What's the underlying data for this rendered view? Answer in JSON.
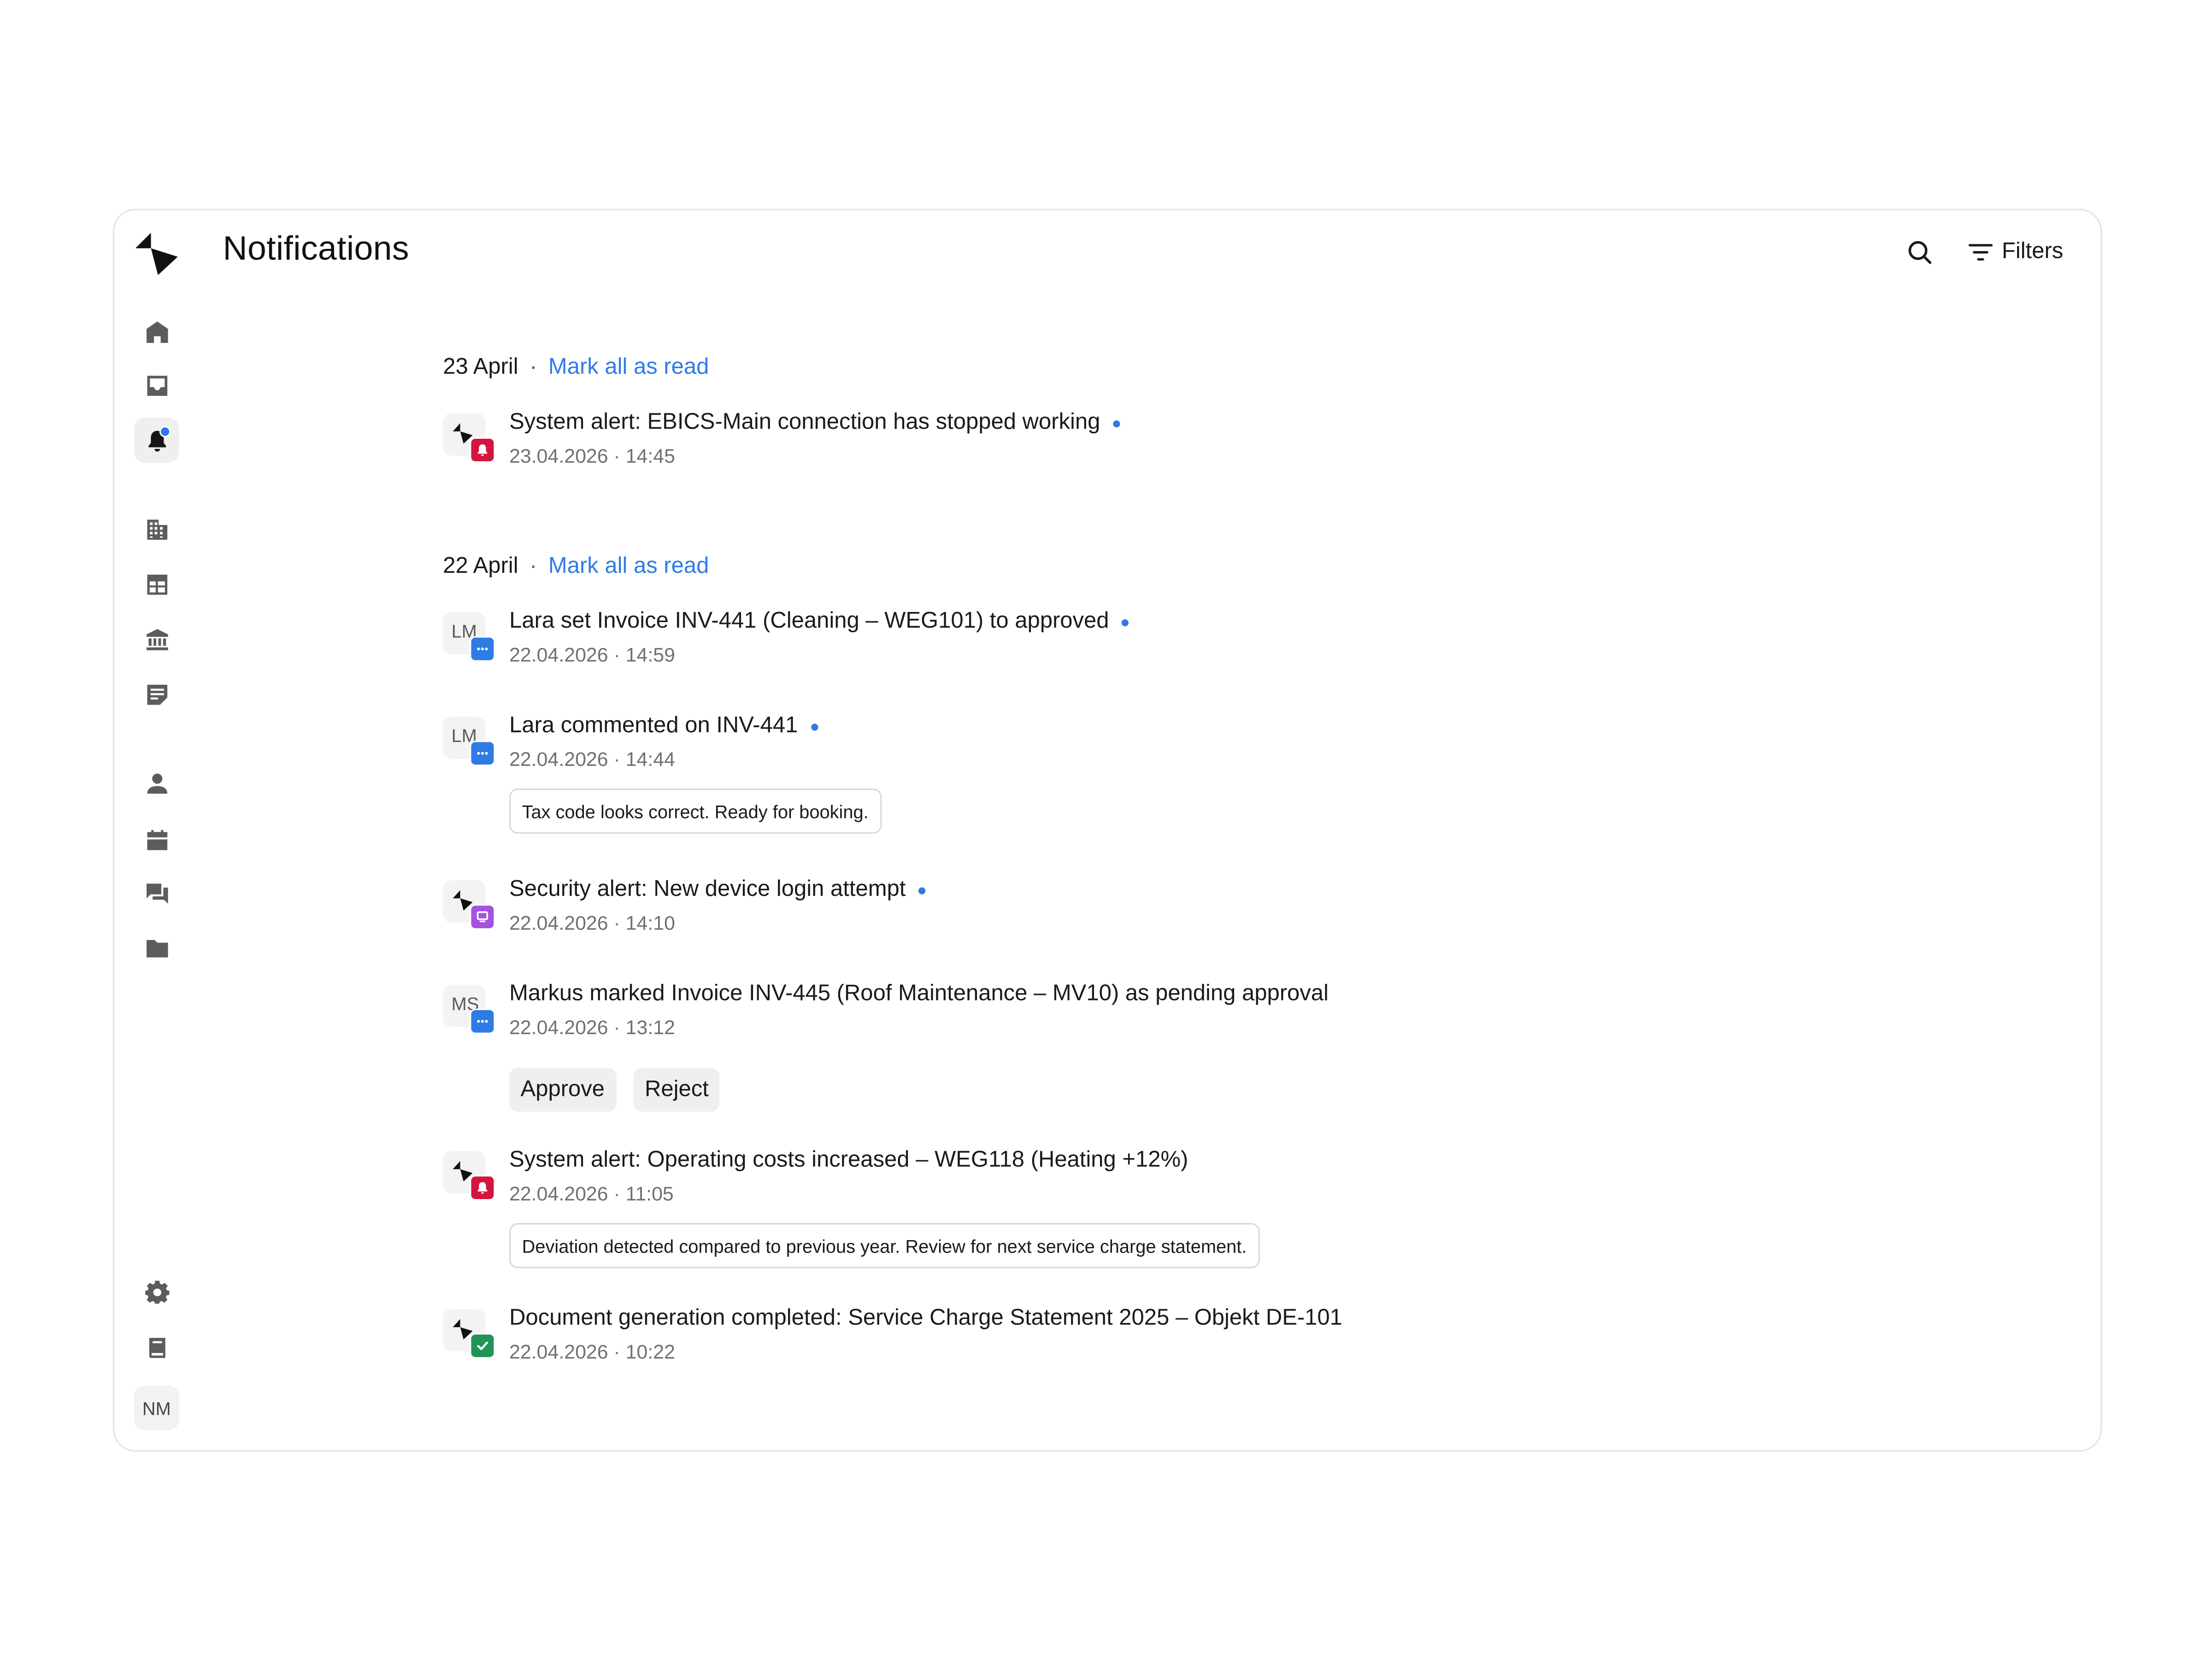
{
  "page": {
    "title": "Notifications"
  },
  "header": {
    "filters_label": "Filters",
    "search_icon": "search-icon",
    "filter_icon": "filter-icon"
  },
  "sidebar": {
    "items": [
      {
        "name": "home",
        "icon": "home-icon"
      },
      {
        "name": "inbox",
        "icon": "inbox-icon"
      },
      {
        "name": "notifications",
        "icon": "bell-icon",
        "active": true,
        "has_unread": true
      },
      {
        "name": "properties",
        "icon": "building-icon"
      },
      {
        "name": "accounting",
        "icon": "table-icon"
      },
      {
        "name": "bank",
        "icon": "bank-icon"
      },
      {
        "name": "documents",
        "icon": "document-icon"
      },
      {
        "name": "contacts",
        "icon": "person-icon"
      },
      {
        "name": "calendar",
        "icon": "calendar-icon"
      },
      {
        "name": "messages",
        "icon": "chat-icon"
      },
      {
        "name": "files",
        "icon": "folder-icon"
      },
      {
        "name": "settings",
        "icon": "gear-icon"
      },
      {
        "name": "guide",
        "icon": "book-icon"
      }
    ],
    "user_initials": "NM"
  },
  "colors": {
    "accent": "#2f7be6",
    "alert_red": "#d4153f",
    "security_purple": "#a452e0",
    "success_green": "#1f9455",
    "comment_blue": "#2f7be6"
  },
  "groups": [
    {
      "date": "23 April",
      "separator": "·",
      "mark_all_label": "Mark all as read",
      "notifications": [
        {
          "title": "System alert: EBICS-Main connection has stopped working",
          "time": "23.04.2026 · 14:45",
          "unread": true,
          "source": "system",
          "type": "alert"
        }
      ]
    },
    {
      "date": "22 April",
      "separator": "·",
      "mark_all_label": "Mark all as read",
      "notifications": [
        {
          "title": "Lara set Invoice INV-441 (Cleaning – WEG101) to approved",
          "time": "22.04.2026 · 14:59",
          "unread": true,
          "source": "user",
          "initials": "LM",
          "type": "comment"
        },
        {
          "title": "Lara commented on INV-441",
          "time": "22.04.2026 · 14:44",
          "unread": true,
          "source": "user",
          "initials": "LM",
          "type": "comment",
          "comment": "Tax code looks correct. Ready for booking."
        },
        {
          "title": "Security alert: New device login attempt",
          "time": "22.04.2026 · 14:10",
          "unread": true,
          "source": "system",
          "type": "security"
        },
        {
          "title": "Markus marked Invoice INV-445 (Roof Maintenance – MV10) as pending approval",
          "time": "22.04.2026 · 13:12",
          "unread": false,
          "source": "user",
          "initials": "MS",
          "type": "comment",
          "actions": [
            "Approve",
            "Reject"
          ]
        },
        {
          "title": "System alert: Operating costs increased – WEG118 (Heating +12%)",
          "time": "22.04.2026 · 11:05",
          "unread": false,
          "source": "system",
          "type": "alert",
          "comment": "Deviation detected compared to previous year. Review for next service charge statement."
        },
        {
          "title": "Document generation completed: Service Charge Statement 2025 – Objekt DE-101",
          "time": "22.04.2026 · 10:22",
          "unread": false,
          "source": "system",
          "type": "success"
        }
      ]
    }
  ]
}
